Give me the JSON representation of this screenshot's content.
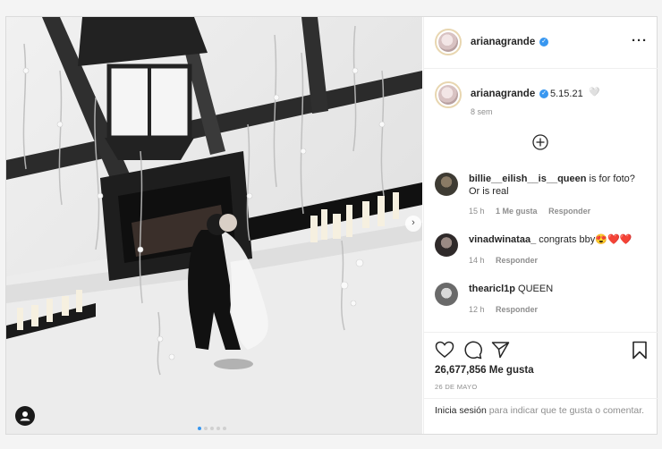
{
  "post": {
    "author": "arianagrande",
    "more_icon": "more-horizontal-icon"
  },
  "caption": {
    "author": "arianagrande",
    "text": "5.15.21",
    "emoji": "🤍",
    "time": "8 sem"
  },
  "comments": [
    {
      "user": "billie__eilish__is__queen",
      "text": "is for foto? Or is real",
      "time": "15 h",
      "likes": "1 Me gusta",
      "reply": "Responder"
    },
    {
      "user": "vinadwinataa_",
      "text": "congrats bby😍❤️❤️",
      "time": "14 h",
      "reply": "Responder"
    },
    {
      "user": "thearicl1p",
      "text": "QUEEN",
      "time": "12 h",
      "reply": "Responder"
    }
  ],
  "likes_count": "26,677,856 Me gusta",
  "date": "26 DE MAYO",
  "login": {
    "link": "Inicia sesión",
    "text": " para indicar que te gusta o comentar."
  },
  "icons": {
    "like": "heart-icon",
    "comment": "comment-icon",
    "share": "paper-plane-icon",
    "save": "bookmark-icon",
    "load_more": "plus-circle-icon",
    "next": "chevron-right-icon",
    "user": "user-tag-icon"
  }
}
